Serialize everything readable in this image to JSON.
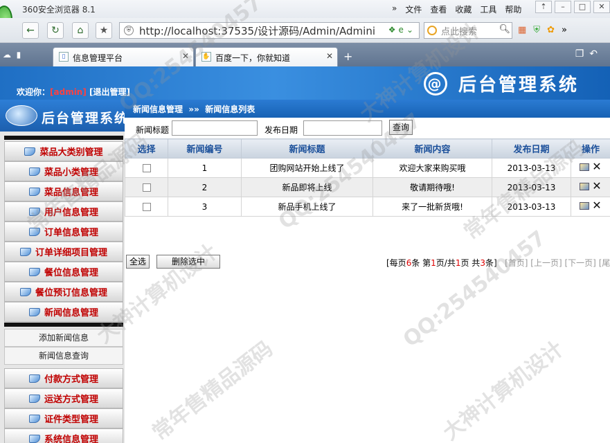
{
  "browser": {
    "name": "360安全浏览器 8.1",
    "menu": [
      "»",
      "文件",
      "查看",
      "收藏",
      "工具",
      "帮助"
    ],
    "address": "http://localhost:37535/设计源码/Admin/Admini",
    "search_placeholder": "点此搜索",
    "tabs": [
      {
        "label": "信息管理平台",
        "active": true
      },
      {
        "label": "百度一下，你就知道",
        "active": false
      }
    ]
  },
  "header": {
    "welcome_prefix": "欢迎你：",
    "username": "[admin]",
    "logout": "[退出管理]",
    "system_title": "后台管理系统"
  },
  "sidebar": {
    "logo_title": "后台管理系统",
    "menu_top": [
      "菜品大类别管理",
      "菜品小类管理",
      "菜品信息管理",
      "用户信息管理",
      "订单信息管理",
      "订单详细项目管理",
      "餐位信息管理",
      "餐位预订信息管理",
      "新闻信息管理"
    ],
    "submenu": [
      "添加新闻信息",
      "新闻信息查询"
    ],
    "menu_bottom": [
      "付款方式管理",
      "运送方式管理",
      "证件类型管理",
      "系统信息管理"
    ]
  },
  "breadcrumb": {
    "section": "新闻信息管理",
    "separator": "»»",
    "page": "新闻信息列表"
  },
  "filter": {
    "title_label": "新闻标题",
    "date_label": "发布日期",
    "title_value": "",
    "date_value": "",
    "query_button": "查询"
  },
  "table": {
    "headers": [
      "选择",
      "新闻编号",
      "新闻标题",
      "新闻内容",
      "发布日期",
      "操作"
    ],
    "rows": [
      {
        "id": "1",
        "title": "团购网站开始上线了",
        "content": "欢迎大家来购买哦",
        "date": "2013-03-13"
      },
      {
        "id": "2",
        "title": "新品即将上线",
        "content": "敬请期待哦!",
        "date": "2013-03-13"
      },
      {
        "id": "3",
        "title": "新品手机上线了",
        "content": "来了一批新货哦!",
        "date": "2013-03-13"
      }
    ]
  },
  "footer": {
    "select_all": "全选",
    "delete_selected": "删除选中",
    "pager": {
      "per_page_prefix": "[每页",
      "per_page": "6",
      "per_page_suffix": "条 第",
      "current_page": "1",
      "page_mid": "页/共",
      "total_pages": "1",
      "page_total_suffix": "页 共",
      "total_items": "3",
      "items_suffix": "条]",
      "first": "[首页]",
      "prev": "[上一页]",
      "next": "[下一页]",
      "last": "[尾页]"
    }
  },
  "watermark_text": [
    "QQ:254540457",
    "大神计算机设计",
    "常年售精品源码"
  ]
}
